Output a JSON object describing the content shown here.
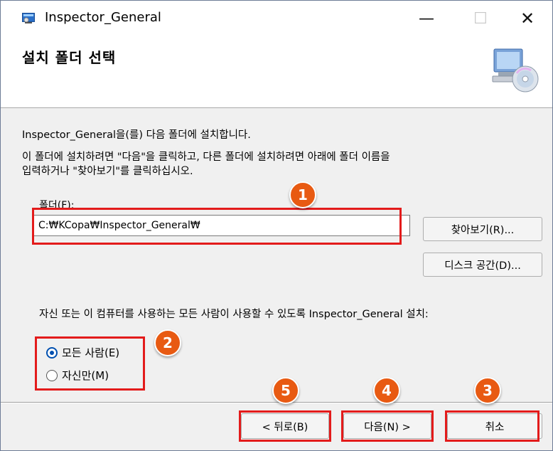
{
  "window": {
    "title": "Inspector_General",
    "minimize_symbol": "—",
    "maximize_symbol": "☐",
    "close_symbol": "✕"
  },
  "header": {
    "title": "설치 폴더 선택"
  },
  "body": {
    "intro": "Inspector_General을(를) 다음 폴더에 설치합니다.",
    "instructions_line1": "이 폴더에 설치하려면 \"다음\"을 클릭하고, 다른 폴더에 설치하려면 아래에 폴더 이름을",
    "instructions_line2": "입력하거나 \"찾아보기\"를 클릭하십시오.",
    "folder_label": "폴더(F):",
    "folder_value": "C:₩KCopa₩Inspector_General₩",
    "browse_button": "찾아보기(R)...",
    "disk_space_button": "디스크 공간(D)...",
    "install_for_label": "자신 또는 이 컴퓨터를 사용하는 모든 사람이 사용할 수 있도록 Inspector_General 설치:",
    "radio_everyone": "모든 사람(E)",
    "radio_just_me": "자신만(M)",
    "selected_option": "everyone"
  },
  "footer": {
    "back_button": "< 뒤로(B)",
    "next_button": "다음(N) >",
    "cancel_button": "취소"
  },
  "annotations": {
    "badges": [
      "1",
      "2",
      "3",
      "4",
      "5"
    ],
    "color": "#e31b1b",
    "badge_color": "#e85a12"
  }
}
